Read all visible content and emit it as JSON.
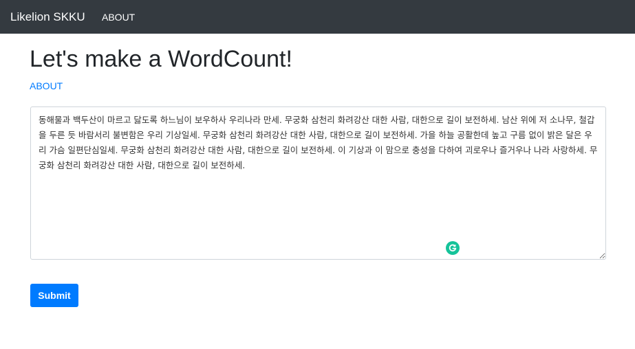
{
  "navbar": {
    "brand": "Likelion SKKU",
    "link": "ABOUT",
    "background": "#343a40"
  },
  "main": {
    "title": "Let's make a WordCount!",
    "about_link": "ABOUT",
    "textarea_value": "동해물과 백두산이 마르고 닳도록 하느님이 보우하사 우리나라 만세. 무궁화 삼천리 화려강산 대한 사람, 대한으로 길이 보전하세. 남산 위에 저 소나무, 철갑을 두른 듯 바람서리 불변함은 우리 기상일세. 무궁화 삼천리 화려강산 대한 사람, 대한으로 길이 보전하세. 가을 하늘 공활한데 높고 구름 없이 밝은 달은 우리 가슴 일편단심일세. 무궁화 삼천리 화려강산 대한 사람, 대한으로 길이 보전하세. 이 기상과 이 맘으로 충성을 다하여 괴로우나 즐거우나 나라 사랑하세. 무궁화 삼천리 화려강산 대한 사람, 대한으로 길이 보전하세.",
    "submit_label": "Submit",
    "grammarly_icon": "grammarly-icon"
  },
  "colors": {
    "link": "#007bff",
    "button": "#007bff",
    "grammarly": "#15c39a"
  }
}
